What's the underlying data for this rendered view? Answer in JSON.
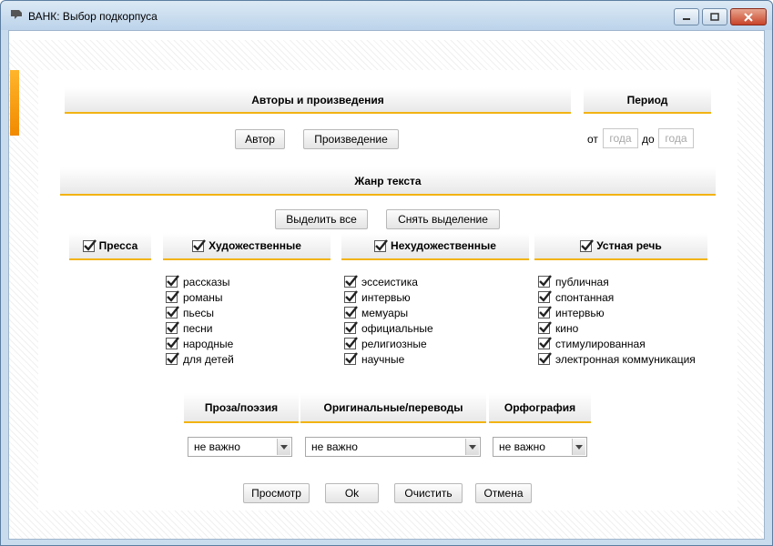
{
  "window": {
    "title": "ВАНК: Выбор подкорпуса"
  },
  "authors": {
    "header": "Авторы и произведения",
    "author_button": "Автор",
    "work_button": "Произведение"
  },
  "period": {
    "header": "Период",
    "from_label": "от",
    "to_label": "до",
    "from_placeholder": "года",
    "to_placeholder": "года"
  },
  "genre": {
    "header": "Жанр текста",
    "select_all": "Выделить все",
    "clear_selection": "Снять выделение",
    "categories": [
      {
        "label": "Пресса",
        "checked": true,
        "items": []
      },
      {
        "label": "Художественные",
        "checked": true,
        "items": [
          {
            "label": "рассказы",
            "checked": true
          },
          {
            "label": "романы",
            "checked": true
          },
          {
            "label": "пьесы",
            "checked": true
          },
          {
            "label": "песни",
            "checked": true
          },
          {
            "label": "народные",
            "checked": true
          },
          {
            "label": "для детей",
            "checked": true
          }
        ]
      },
      {
        "label": "Нехудожественные",
        "checked": true,
        "items": [
          {
            "label": "эссеистика",
            "checked": true
          },
          {
            "label": "интервью",
            "checked": true
          },
          {
            "label": "мемуары",
            "checked": true
          },
          {
            "label": "официальные",
            "checked": true
          },
          {
            "label": "религиозные",
            "checked": true
          },
          {
            "label": "научные",
            "checked": true
          }
        ]
      },
      {
        "label": "Устная речь",
        "checked": true,
        "items": [
          {
            "label": "публичная",
            "checked": true
          },
          {
            "label": "спонтанная",
            "checked": true
          },
          {
            "label": "интервью",
            "checked": true
          },
          {
            "label": "кино",
            "checked": true
          },
          {
            "label": "стимулированная",
            "checked": true
          },
          {
            "label": "электронная коммуникация",
            "checked": true
          }
        ]
      }
    ]
  },
  "filters": {
    "prose_poetry": {
      "header": "Проза/поэзия",
      "value": "не важно"
    },
    "original_translation": {
      "header": "Оригинальные/переводы",
      "value": "не важно"
    },
    "orthography": {
      "header": "Орфография",
      "value": "не важно"
    }
  },
  "actions": {
    "preview": "Просмотр",
    "ok": "Ok",
    "clear": "Очистить",
    "cancel": "Отмена"
  },
  "colors": {
    "accent": "#f2b313",
    "tab": "#f18a00"
  }
}
